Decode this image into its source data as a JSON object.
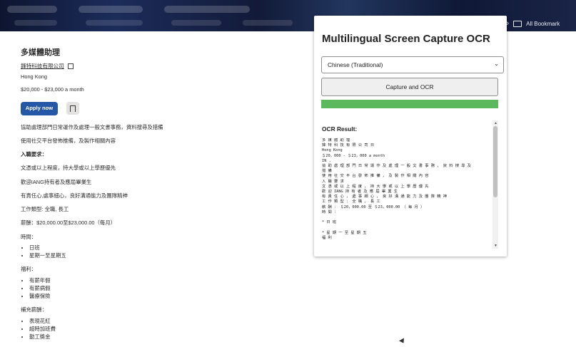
{
  "browser": {
    "bookmarks_label": "All Bookmark"
  },
  "job": {
    "title": "多媒體助理",
    "company": "鋒特科技有限公司",
    "location": "Hong Kong",
    "salary": "$20,000 - $23,000 a month",
    "apply_label": "Apply now",
    "desc1": "協助處理部門日常運作及處理一般文書事務，資料搜尋及措備",
    "desc2": "使用社交平台發佈推備，及製作相關內容",
    "requirements_heading": "入職要求：",
    "req1": "文憑或以上程度，持大學或以上學歷優先",
    "req2": "歡迎IANG持有者及應屆畢業生",
    "req3": "有責任心,處事細心，良好溝通能力及團隊精神",
    "job_type": "工作類型: 全職, 長工",
    "pay": "薪酬：$20,000.00至$23,000.00（每月）",
    "hours_heading": "時間：",
    "hours": [
      "日班",
      "星期一至星期五"
    ],
    "benefits_heading": "福利：",
    "benefits": [
      "有薪年假",
      "有薪病假",
      "醫療保險"
    ],
    "extra_heading": "補充薪酬：",
    "extra": [
      "表現花紅",
      "超時加班費",
      "勤工獎金"
    ]
  },
  "popup": {
    "title": "Multilingual Screen Capture OCR",
    "language_selected": "Chinese (Traditional)",
    "capture_label": "Capture and OCR",
    "progress": 1.0,
    "result_label": "OCR Result:",
    "result_text": "多 媒 體 助 理\n鋒 特 科 技 有 限 公 司 日\nHong Kong\n＄20，000 - ＄23，000 a month\nIN ,\n協 助 處 理 部 門 日 常 運 作 及 處 理 一 般 文 書 事 務 ， 資 料 搜 尋 及\n措 備\n使 用 社 交 平 台 發 佈 推 備 ， 及 製 作 相 關 內 容\n入 職 要 求\n文 憑 或 以 上 程 度 ， 持 大 學 或 以 上 學 歷 優 先\n歡 迎 IANG 持 有 者 及 應 屆 畢 業 生\n有 責 任 心 ， 處 事 細 心 ， 良 好 溝 通 能 力 及 團 隊 精 神\n工 作 類 型 ： 全 職 ， 長 工\n薪 酬 ： ＄20，000.00 至 ＄23，000.00 （ 每 月 ）\n時 間 ：\n\n* 日 班\n\n* 星 期 一 至 星 期 五\n福 利"
  },
  "colors": {
    "apply": "#2557a7",
    "progress": "#5cb85c"
  }
}
